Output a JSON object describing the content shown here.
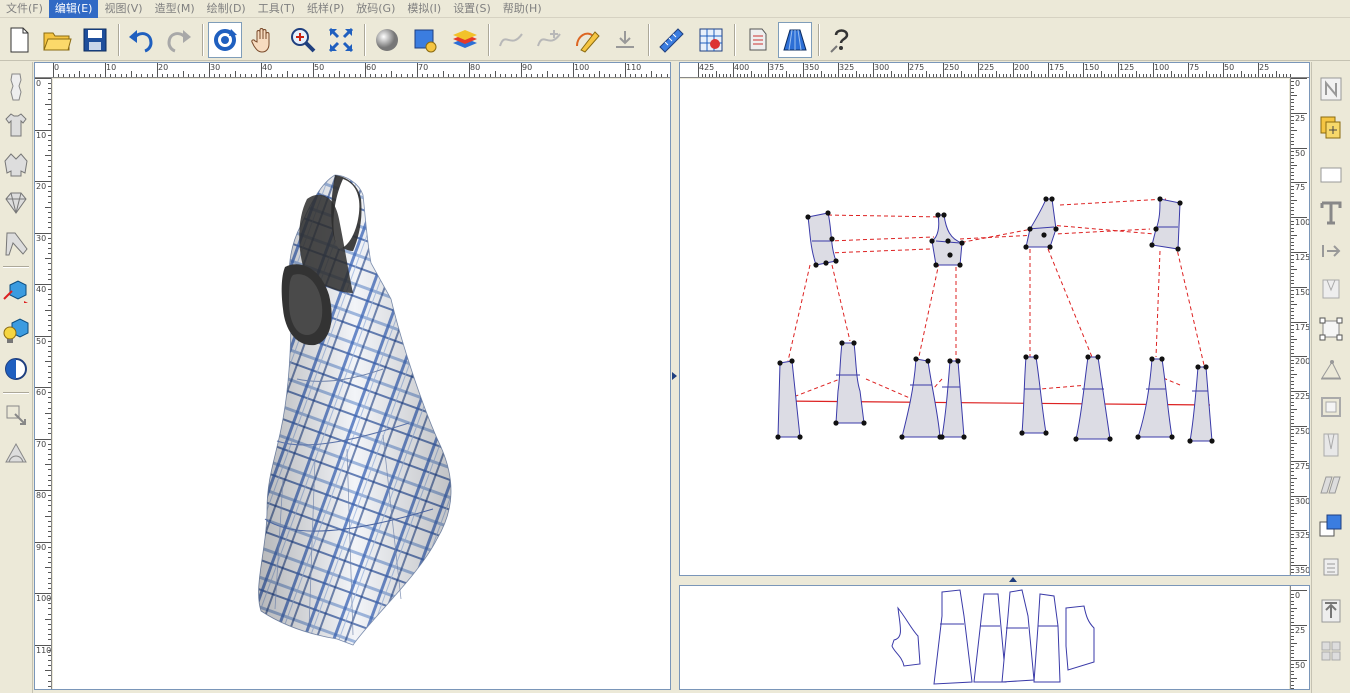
{
  "menu": {
    "items": [
      {
        "label": "文件(F)"
      },
      {
        "label": "编辑(E)",
        "active": true
      },
      {
        "label": "视图(V)"
      },
      {
        "label": "造型(M)"
      },
      {
        "label": "绘制(D)"
      },
      {
        "label": "工具(T)"
      },
      {
        "label": "纸样(P)"
      },
      {
        "label": "放码(G)"
      },
      {
        "label": "模拟(I)"
      },
      {
        "label": "设置(S)"
      },
      {
        "label": "帮助(H)"
      }
    ]
  },
  "toolbar": {
    "buttons": [
      "new-file",
      "open-folder",
      "save",
      "undo",
      "redo",
      "rotate-view",
      "pan-hand",
      "zoom",
      "fit-view",
      "sphere",
      "select-box",
      "layers",
      "curve",
      "curve-add",
      "pencil",
      "measure-down",
      "ruler",
      "grid-map",
      "fabric",
      "skirt",
      "help"
    ],
    "pressed": [
      "rotate-view",
      "skirt"
    ]
  },
  "rulers": {
    "left_h": [
      "0",
      "10",
      "20",
      "30",
      "40",
      "50",
      "60",
      "70",
      "80",
      "90",
      "100",
      "110"
    ],
    "left_v": [
      "0",
      "10",
      "20",
      "30",
      "40",
      "50",
      "60",
      "70",
      "80",
      "90",
      "100",
      "110"
    ],
    "right_h": [
      "425",
      "400",
      "375",
      "350",
      "325",
      "300",
      "275",
      "250",
      "225",
      "200",
      "175",
      "150",
      "125",
      "100",
      "75",
      "50",
      "25"
    ],
    "right_v": [
      "0",
      "25",
      "50",
      "75",
      "100",
      "125",
      "150",
      "175",
      "200",
      "225",
      "250",
      "275",
      "300",
      "325",
      "350"
    ],
    "bottom_v": [
      "0",
      "25",
      "50"
    ]
  },
  "colors": {
    "piece_fill": "#dcdce4",
    "piece_stroke": "#3a3aa8",
    "stitch_red": "#dd2222",
    "active_menu": "#316ac5"
  }
}
